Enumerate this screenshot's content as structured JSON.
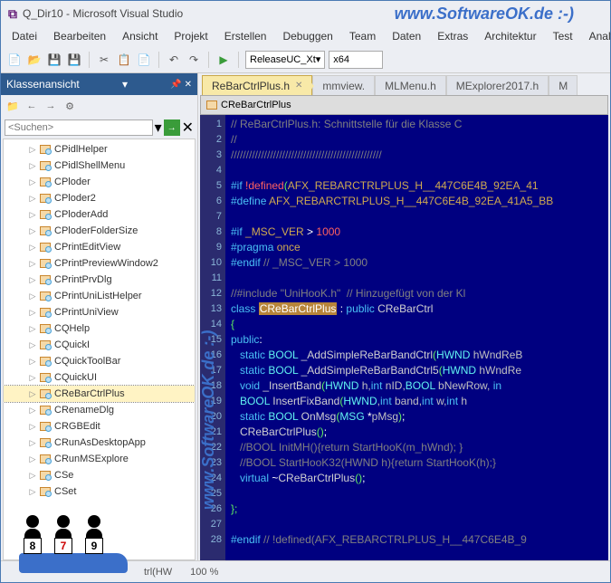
{
  "window": {
    "title": "Q_Dir10 - Microsoft Visual Studio"
  },
  "watermark": "www.SoftwareOK.de :-)",
  "menu": [
    "Datei",
    "Bearbeiten",
    "Ansicht",
    "Projekt",
    "Erstellen",
    "Debuggen",
    "Team",
    "Daten",
    "Extras",
    "Architektur",
    "Test",
    "Analyse"
  ],
  "toolbar": {
    "config": "ReleaseUC_Xt",
    "platform": "x64"
  },
  "sidebar": {
    "title": "Klassenansicht",
    "search_placeholder": "<Suchen>",
    "items": [
      {
        "label": "CPidlHelper"
      },
      {
        "label": "CPidlShellMenu"
      },
      {
        "label": "CPloder"
      },
      {
        "label": "CPloder2"
      },
      {
        "label": "CPloderAdd"
      },
      {
        "label": "CPloderFolderSize"
      },
      {
        "label": "CPrintEditView"
      },
      {
        "label": "CPrintPreviewWindow2"
      },
      {
        "label": "CPrintPrvDlg"
      },
      {
        "label": "CPrintUniListHelper"
      },
      {
        "label": "CPrintUniView"
      },
      {
        "label": "CQHelp"
      },
      {
        "label": "CQuickI"
      },
      {
        "label": "CQuickToolBar"
      },
      {
        "label": "CQuickUI"
      },
      {
        "label": "CReBarCtrlPlus",
        "sel": true
      },
      {
        "label": "CRenameDlg"
      },
      {
        "label": "CRGBEdit"
      },
      {
        "label": "CRunAsDesktopApp"
      },
      {
        "label": "CRunMSExplore"
      },
      {
        "label": "CSe"
      },
      {
        "label": "CSet"
      }
    ]
  },
  "tabs": [
    {
      "label": "ReBarCtrlPlus.h",
      "active": true
    },
    {
      "label": "mmview."
    },
    {
      "label": "MLMenu.h"
    },
    {
      "label": "MExplorer2017.h"
    },
    {
      "label": "M"
    }
  ],
  "navbar": {
    "class": "CReBarCtrlPlus"
  },
  "code": {
    "lines": [
      {
        "n": 1,
        "t": "com",
        "txt": "// ReBarCtrlPlus.h: Schnittstelle für die Klasse C"
      },
      {
        "n": 2,
        "t": "com",
        "txt": "//"
      },
      {
        "n": 3,
        "t": "com",
        "txt": "//////////////////////////////////////////////////"
      },
      {
        "n": 4,
        "t": "blank",
        "txt": ""
      },
      {
        "n": 5,
        "t": "ifdef",
        "txt": "#if !defined(AFX_REBARCTRLPLUS_H__447C6E4B_92EA_41"
      },
      {
        "n": 6,
        "t": "def",
        "txt": "#define AFX_REBARCTRLPLUS_H__447C6E4B_92EA_41A5_BB"
      },
      {
        "n": 7,
        "t": "blank",
        "txt": ""
      },
      {
        "n": 8,
        "t": "ifver",
        "txt": "#if _MSC_VER > 1000"
      },
      {
        "n": 9,
        "t": "pp",
        "txt": "#pragma once"
      },
      {
        "n": 10,
        "t": "endif",
        "txt": "#endif // _MSC_VER > 1000"
      },
      {
        "n": 11,
        "t": "blank",
        "txt": ""
      },
      {
        "n": 12,
        "t": "com",
        "txt": "//#include \"UniHooK.h\"  // Hinzugefügt von der Kl"
      },
      {
        "n": 13,
        "t": "class",
        "txt": "class CReBarCtrlPlus : public CReBarCtrl"
      },
      {
        "n": 14,
        "t": "br",
        "txt": "{"
      },
      {
        "n": 15,
        "t": "pub",
        "txt": "public:"
      },
      {
        "n": 16,
        "t": "stat",
        "txt": "   static BOOL _AddSimpleReBarBandCtrl(HWND hWndReB"
      },
      {
        "n": 17,
        "t": "stat",
        "txt": "   static BOOL _AddSimpleReBarBandCtrl5(HWND hWndRe"
      },
      {
        "n": 18,
        "t": "void",
        "txt": "   void _InsertBand(HWND h,int nID,BOOL bNewRow, in"
      },
      {
        "n": 19,
        "t": "bool",
        "txt": "   BOOL InsertFixBand(HWND,int band,int w,int h"
      },
      {
        "n": 20,
        "t": "stat2",
        "txt": "   static BOOL OnMsg(MSG *pMsg);"
      },
      {
        "n": 21,
        "t": "ctor",
        "txt": "   CReBarCtrlPlus();"
      },
      {
        "n": 22,
        "t": "com",
        "txt": "   //BOOL InitMH(){return StartHooK(m_hWnd); }"
      },
      {
        "n": 23,
        "t": "com",
        "txt": "   //BOOL StartHooK32(HWND h){return StartHooK(h);}"
      },
      {
        "n": 24,
        "t": "virt",
        "txt": "   virtual ~CReBarCtrlPlus();"
      },
      {
        "n": 25,
        "t": "blank",
        "txt": ""
      },
      {
        "n": 26,
        "t": "br",
        "txt": "};"
      },
      {
        "n": 27,
        "t": "blank",
        "txt": ""
      },
      {
        "n": 28,
        "t": "endif2",
        "txt": "#endif // !defined(AFX_REBARCTRLPLUS_H__447C6E4B_9"
      }
    ]
  },
  "status": {
    "hint": "trl(HW",
    "zoom": "100 %"
  },
  "figs": [
    "8",
    "7",
    "9"
  ]
}
